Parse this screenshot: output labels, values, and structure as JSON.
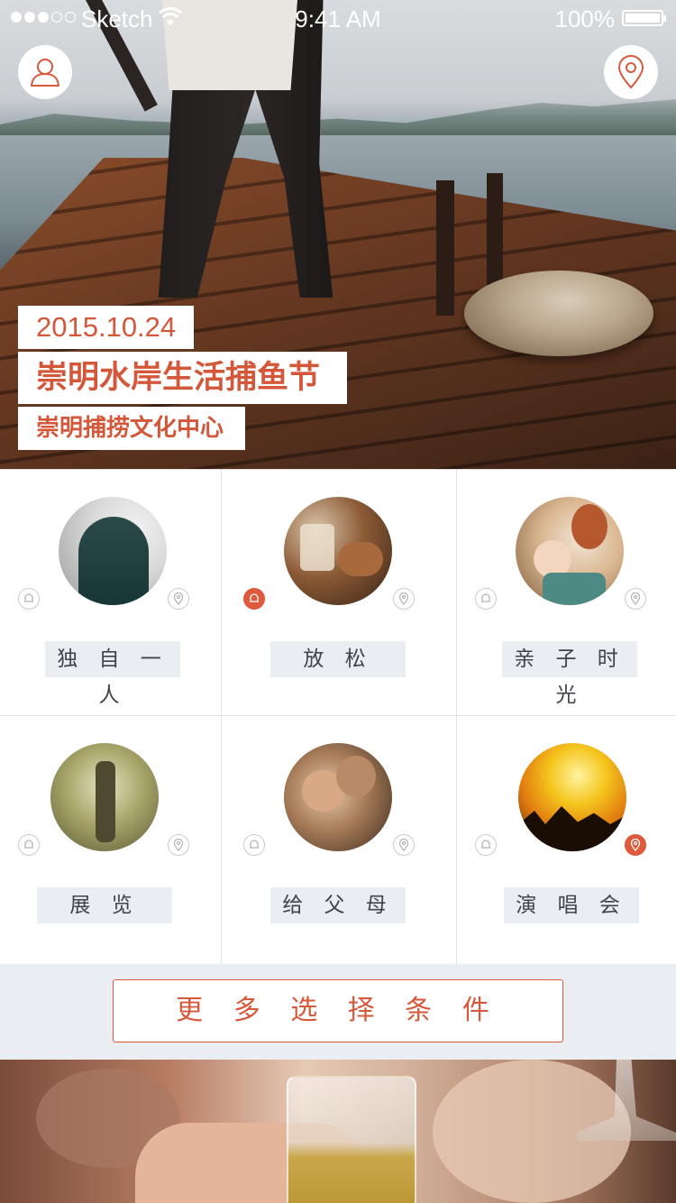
{
  "status_bar": {
    "carrier": "Sketch",
    "time": "9:41 AM",
    "battery": "100%",
    "signal_bars_filled": 3,
    "signal_bars_total": 5
  },
  "header": {
    "left_icon": "user-profile-icon",
    "right_icon": "location-pin-icon"
  },
  "hero": {
    "date": "2015.10.24",
    "title": "崇明水岸生活捕鱼节",
    "venue": "崇明捕捞文化中心"
  },
  "categories": [
    {
      "label": "独 自 一 人",
      "liked": false,
      "location_active": false
    },
    {
      "label": "放 松",
      "liked": true,
      "location_active": false
    },
    {
      "label": "亲 子 时 光",
      "liked": false,
      "location_active": false
    },
    {
      "label": "展 览",
      "liked": false,
      "location_active": false
    },
    {
      "label": "给 父 母",
      "liked": false,
      "location_active": false
    },
    {
      "label": "演 唱 会",
      "liked": false,
      "location_active": true
    }
  ],
  "more_button": {
    "label": "更 多 选 择 条 件"
  },
  "colors": {
    "accent": "#d7583a",
    "label_bg": "#eaeef2",
    "divider": "#dfe3e7"
  }
}
